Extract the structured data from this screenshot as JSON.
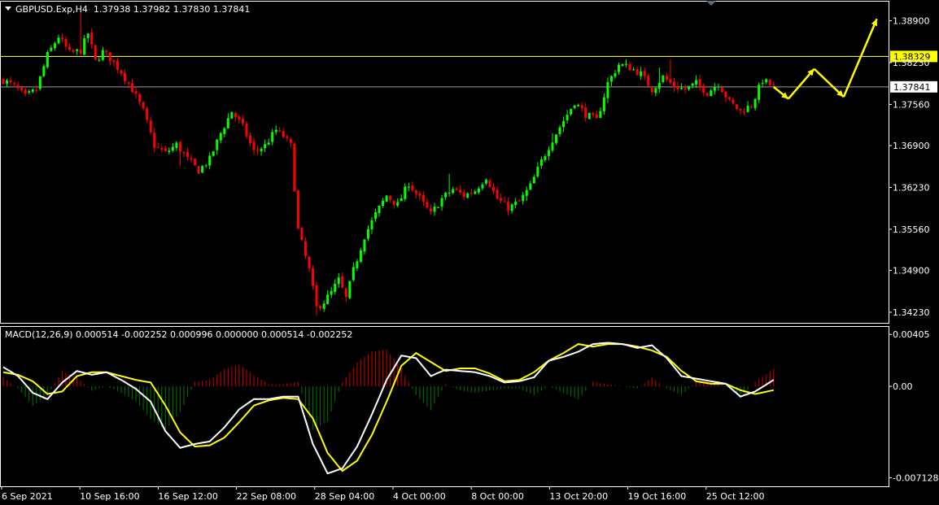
{
  "header": {
    "symbol": "GBPUSD.Exp,H4",
    "open": "1.37938",
    "high": "1.37982",
    "low": "1.37830",
    "close": "1.37841"
  },
  "macd_header": {
    "label": "MACD(12,26,9)",
    "values": "0.000514 -0.002252 0.000996 0.000000 0.000514 -0.002252"
  },
  "price_axis": {
    "ticks": [
      {
        "label": "1.38900",
        "value": 1.389
      },
      {
        "label": "1.38230",
        "value": 1.3823
      },
      {
        "label": "1.37560",
        "value": 1.3756
      },
      {
        "label": "1.36900",
        "value": 1.369
      },
      {
        "label": "1.36230",
        "value": 1.3623
      },
      {
        "label": "1.35560",
        "value": 1.3556
      },
      {
        "label": "1.34900",
        "value": 1.349
      },
      {
        "label": "1.34230",
        "value": 1.3423
      }
    ],
    "markers": [
      {
        "label": "1.38329",
        "value": 1.38329,
        "bg": "#ffff00",
        "fg": "#000000",
        "line": "#ffff66"
      },
      {
        "label": "1.37841",
        "value": 1.37841,
        "bg": "#ffffff",
        "fg": "#000000",
        "line": "#9aa0a8"
      }
    ]
  },
  "macd_axis": {
    "ticks": [
      {
        "label": "0.00405",
        "value": 0.00405
      },
      {
        "label": "0.00",
        "value": 0
      },
      {
        "label": "-0.007128",
        "value": -0.007128
      }
    ]
  },
  "time_axis": [
    "6 Sep 2021",
    "10 Sep 16:00",
    "16 Sep 12:00",
    "22 Sep 08:00",
    "28 Sep 04:00",
    "4 Oct 00:00",
    "8 Oct 00:00",
    "13 Oct 20:00",
    "19 Oct 16:00",
    "25 Oct 12:00"
  ],
  "colors": {
    "bull": "#00ff00",
    "bear": "#ff0000",
    "macd_line": "#ffffff",
    "signal_line": "#ffff00",
    "hist_pos": "#b00000",
    "hist_neg": "#006400",
    "grid": "#ffffff",
    "arrow": "#ffff00"
  },
  "chart_data": {
    "type": "candlestick",
    "price_ylim": [
      1.3406,
      1.3922
    ],
    "price_path": [
      [
        0,
        1.3795
      ],
      [
        3,
        1.3785
      ],
      [
        6,
        1.3768
      ],
      [
        9,
        1.378
      ],
      [
        12,
        1.3835
      ],
      [
        15,
        1.3865
      ],
      [
        18,
        1.3838
      ],
      [
        21,
        1.3842
      ],
      [
        23,
        1.387
      ],
      [
        25,
        1.3825
      ],
      [
        27,
        1.384
      ],
      [
        29,
        1.383
      ],
      [
        32,
        1.3808
      ],
      [
        35,
        1.378
      ],
      [
        38,
        1.3745
      ],
      [
        41,
        1.369
      ],
      [
        44,
        1.3678
      ],
      [
        47,
        1.3692
      ],
      [
        50,
        1.3668
      ],
      [
        53,
        1.365
      ],
      [
        56,
        1.3668
      ],
      [
        59,
        1.371
      ],
      [
        62,
        1.3745
      ],
      [
        65,
        1.372
      ],
      [
        68,
        1.368
      ],
      [
        71,
        1.369
      ],
      [
        74,
        1.3715
      ],
      [
        76,
        1.3705
      ],
      [
        78,
        1.369
      ],
      [
        80,
        1.3555
      ],
      [
        83,
        1.349
      ],
      [
        85,
        1.343
      ],
      [
        87,
        1.344
      ],
      [
        89,
        1.3455
      ],
      [
        91,
        1.3475
      ],
      [
        93,
        1.3445
      ],
      [
        95,
        1.349
      ],
      [
        98,
        1.3545
      ],
      [
        101,
        1.358
      ],
      [
        104,
        1.361
      ],
      [
        107,
        1.3595
      ],
      [
        110,
        1.363
      ],
      [
        113,
        1.3605
      ],
      [
        116,
        1.358
      ],
      [
        119,
        1.3605
      ],
      [
        122,
        1.362
      ],
      [
        125,
        1.361
      ],
      [
        128,
        1.3618
      ],
      [
        131,
        1.364
      ],
      [
        134,
        1.3605
      ],
      [
        137,
        1.359
      ],
      [
        140,
        1.36
      ],
      [
        143,
        1.3625
      ],
      [
        146,
        1.3665
      ],
      [
        149,
        1.37
      ],
      [
        152,
        1.373
      ],
      [
        155,
        1.376
      ],
      [
        158,
        1.374
      ],
      [
        161,
        1.373
      ],
      [
        164,
        1.379
      ],
      [
        167,
        1.382
      ],
      [
        170,
        1.3815
      ],
      [
        173,
        1.3805
      ],
      [
        176,
        1.378
      ],
      [
        179,
        1.38
      ],
      [
        182,
        1.3785
      ],
      [
        185,
        1.378
      ],
      [
        188,
        1.379
      ],
      [
        191,
        1.3775
      ],
      [
        194,
        1.379
      ],
      [
        197,
        1.376
      ],
      [
        200,
        1.3745
      ],
      [
        203,
        1.3755
      ],
      [
        206,
        1.3795
      ],
      [
        209,
        1.3784
      ]
    ],
    "spikes": [
      [
        21,
        1.3905
      ],
      [
        48,
        1.3658
      ],
      [
        78,
        1.37
      ],
      [
        85,
        1.3418
      ],
      [
        121,
        1.3645
      ],
      [
        149,
        1.371
      ],
      [
        178,
        1.3815
      ],
      [
        181,
        1.3828
      ]
    ],
    "macd_ylim": [
      -0.0078,
      0.0047
    ],
    "macd": [
      [
        0,
        0.0015
      ],
      [
        4,
        0.0008
      ],
      [
        8,
        -0.0005
      ],
      [
        12,
        -0.001
      ],
      [
        16,
        0.0003
      ],
      [
        20,
        0.0012
      ],
      [
        24,
        0.0009
      ],
      [
        28,
        0.0011
      ],
      [
        32,
        0.0005
      ],
      [
        36,
        -0.0002
      ],
      [
        40,
        -0.0012
      ],
      [
        44,
        -0.0035
      ],
      [
        48,
        -0.0048
      ],
      [
        52,
        -0.0045
      ],
      [
        56,
        -0.0043
      ],
      [
        60,
        -0.0032
      ],
      [
        64,
        -0.0018
      ],
      [
        68,
        -0.001
      ],
      [
        72,
        -0.001
      ],
      [
        76,
        -0.0008
      ],
      [
        80,
        -0.0008
      ],
      [
        84,
        -0.0045
      ],
      [
        88,
        -0.0068
      ],
      [
        92,
        -0.0064
      ],
      [
        96,
        -0.0047
      ],
      [
        100,
        -0.0022
      ],
      [
        104,
        0.0005
      ],
      [
        108,
        0.0024
      ],
      [
        112,
        0.0022
      ],
      [
        116,
        0.0008
      ],
      [
        120,
        0.0013
      ],
      [
        124,
        0.0012
      ],
      [
        128,
        0.0011
      ],
      [
        132,
        0.0008
      ],
      [
        136,
        0.0003
      ],
      [
        140,
        0.0004
      ],
      [
        144,
        0.0007
      ],
      [
        148,
        0.002
      ],
      [
        152,
        0.0023
      ],
      [
        156,
        0.0027
      ],
      [
        160,
        0.0033
      ],
      [
        164,
        0.0034
      ],
      [
        168,
        0.0033
      ],
      [
        172,
        0.003
      ],
      [
        176,
        0.0032
      ],
      [
        180,
        0.0022
      ],
      [
        184,
        0.0008
      ],
      [
        188,
        0.0006
      ],
      [
        192,
        0.0004
      ],
      [
        196,
        0.0002
      ],
      [
        200,
        -0.0008
      ],
      [
        204,
        -0.0004
      ],
      [
        209,
        0.0005
      ]
    ],
    "signal": [
      [
        0,
        0.0011
      ],
      [
        4,
        0.0009
      ],
      [
        8,
        0.0004
      ],
      [
        12,
        -0.0006
      ],
      [
        16,
        -0.0004
      ],
      [
        20,
        0.0008
      ],
      [
        24,
        0.0011
      ],
      [
        28,
        0.0011
      ],
      [
        32,
        0.0008
      ],
      [
        36,
        0.0005
      ],
      [
        40,
        0.0003
      ],
      [
        44,
        -0.0015
      ],
      [
        48,
        -0.0036
      ],
      [
        52,
        -0.0047
      ],
      [
        56,
        -0.0046
      ],
      [
        60,
        -0.004
      ],
      [
        64,
        -0.0028
      ],
      [
        68,
        -0.0015
      ],
      [
        72,
        -0.0011
      ],
      [
        76,
        -0.0009
      ],
      [
        80,
        -0.001
      ],
      [
        84,
        -0.0025
      ],
      [
        88,
        -0.0052
      ],
      [
        92,
        -0.0066
      ],
      [
        96,
        -0.0058
      ],
      [
        100,
        -0.0038
      ],
      [
        104,
        -0.0012
      ],
      [
        108,
        0.0016
      ],
      [
        112,
        0.0026
      ],
      [
        116,
        0.0019
      ],
      [
        120,
        0.0012
      ],
      [
        124,
        0.0014
      ],
      [
        128,
        0.0014
      ],
      [
        132,
        0.001
      ],
      [
        136,
        0.0004
      ],
      [
        140,
        0.0005
      ],
      [
        144,
        0.0011
      ],
      [
        148,
        0.002
      ],
      [
        152,
        0.0026
      ],
      [
        156,
        0.0033
      ],
      [
        160,
        0.0031
      ],
      [
        164,
        0.0033
      ],
      [
        168,
        0.0033
      ],
      [
        172,
        0.0031
      ],
      [
        176,
        0.0028
      ],
      [
        180,
        0.0023
      ],
      [
        184,
        0.0012
      ],
      [
        188,
        0.0004
      ],
      [
        192,
        0.0002
      ],
      [
        196,
        0.0002
      ],
      [
        200,
        -0.0003
      ],
      [
        204,
        -0.0006
      ],
      [
        209,
        -0.0003
      ]
    ],
    "projection": [
      [
        209,
        1.3784
      ],
      [
        213,
        1.3765
      ],
      [
        220,
        1.3813
      ],
      [
        228,
        1.3768
      ],
      [
        237,
        1.3893
      ]
    ]
  }
}
